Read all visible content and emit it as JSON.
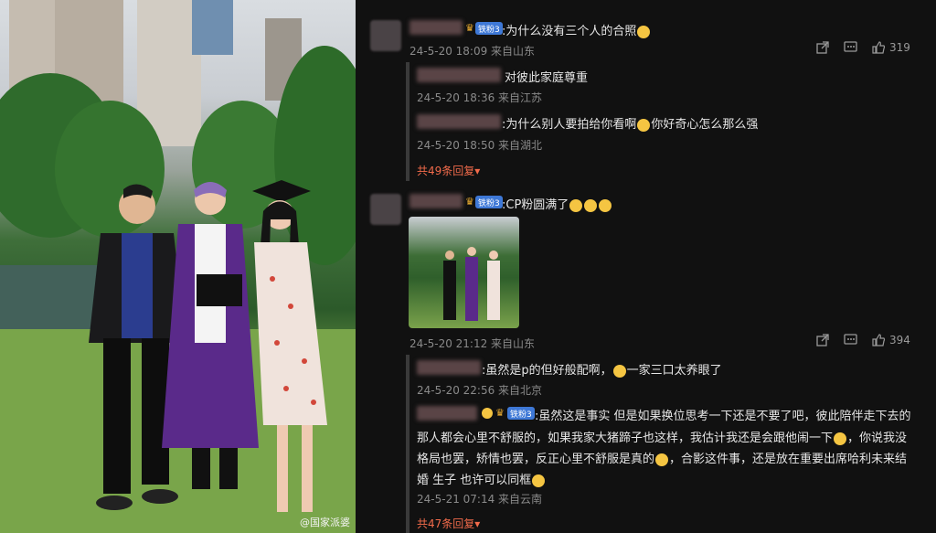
{
  "photo": {
    "watermark": "@国家派婆"
  },
  "comments": [
    {
      "badge": "铁粉3",
      "text": ":为什么没有三个人的合照",
      "meta": "24-5-20 18:09 来自山东",
      "likes": "319",
      "replies": [
        {
          "text": "对彼此家庭尊重",
          "meta": "24-5-20 18:36 来自江苏"
        },
        {
          "text": ":为什么别人要拍给你看啊",
          "text2": "你好奇心怎么那么强",
          "meta": "24-5-20 18:50 来自湖北"
        }
      ],
      "more": "共49条回复▾"
    },
    {
      "badge": "铁粉3",
      "text": ":CP粉圆满了",
      "meta": "24-5-20 21:12 来自山东",
      "likes": "394",
      "replies": [
        {
          "text": ":虽然是p的但好般配啊，",
          "text2": "一家三口太养眼了",
          "meta": "24-5-20 22:56 来自北京"
        },
        {
          "badge": "铁粉3",
          "text": ":虽然这是事实 但是如果换位思考一下还是不要了吧，彼此陪伴走下去的",
          "line2": "那人都会心里不舒服的，如果我家大猪蹄子也这样，我估计我还是会跟他闹一下",
          "line2b": "，你说我没",
          "line3": "格局也罢，矫情也罢，反正心里不舒服是真的",
          "line3b": "，合影这件事，还是放在重要出席哈利未来结",
          "line4": "婚 生子 也许可以同框",
          "meta": "24-5-21 07:14 来自云南"
        }
      ],
      "more": "共47条回复▾"
    }
  ]
}
